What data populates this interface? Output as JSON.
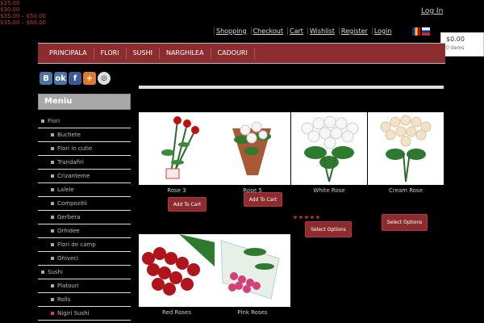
{
  "header": {
    "top_link": "Log In",
    "utility_links": [
      "Shopping",
      "Checkout",
      "Cart",
      "Wishlist",
      "Register",
      "Login"
    ],
    "flags": [
      "ro-flag",
      "ru-flag"
    ]
  },
  "cart": {
    "amount": "$0.00",
    "items": "0 items"
  },
  "nav": {
    "items": [
      "PRINCIPALA",
      "FLORI",
      "SUSHI",
      "NARGHILEA",
      "CADOURI"
    ]
  },
  "social": [
    "vk",
    "ok",
    "f",
    "+",
    "share"
  ],
  "sidebar": {
    "title": "Meniu",
    "items": [
      {
        "label": "Flori",
        "level": "top"
      },
      {
        "label": "Buchete",
        "level": "sub"
      },
      {
        "label": "Flori in cutie",
        "level": "sub"
      },
      {
        "label": "Trandafiri",
        "level": "sub"
      },
      {
        "label": "Crizanteme",
        "level": "sub"
      },
      {
        "label": "Lalele",
        "level": "sub"
      },
      {
        "label": "Compozitii",
        "level": "sub"
      },
      {
        "label": "Gerbera",
        "level": "sub"
      },
      {
        "label": "Orhidee",
        "level": "sub"
      },
      {
        "label": "Flori de camp",
        "level": "sub"
      },
      {
        "label": "Ghiveci",
        "level": "sub"
      },
      {
        "label": "Sushi",
        "level": "top"
      },
      {
        "label": "Platouri",
        "level": "sub"
      },
      {
        "label": "Rolls",
        "level": "sub"
      },
      {
        "label": "Nigiri Sushi",
        "level": "sub"
      }
    ]
  },
  "products": [
    {
      "title": "Rose 3",
      "price": "$25.00",
      "button": "Add To Cart"
    },
    {
      "title": "Rose 5",
      "price": "$30.00",
      "button": "Add To Cart"
    },
    {
      "title": "White Rose",
      "price": "$35.00 – $50.00",
      "button": "Select Options"
    },
    {
      "title": "Cream Rose",
      "price": "$35.00 – $60.00",
      "button": "Select Options"
    },
    {
      "title": "Red Roses",
      "price": "",
      "button": ""
    },
    {
      "title": "Pink Roses",
      "price": "",
      "button": ""
    }
  ],
  "colors": {
    "accent": "#8b2d2f",
    "price": "#c0393b",
    "background": "#000000"
  }
}
